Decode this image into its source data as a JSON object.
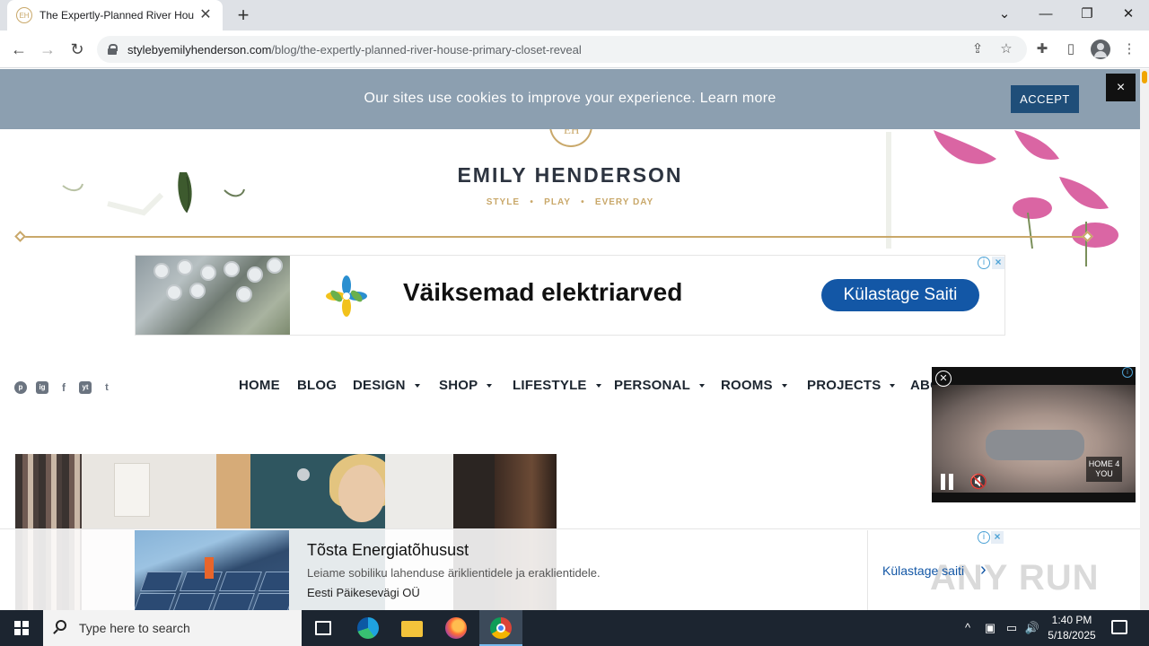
{
  "browser": {
    "tab_title": "The Expertly-Planned River House",
    "tab_favicon": "EH",
    "url_host": "stylebyemilyhenderson.com",
    "url_path": "/blog/the-expertly-planned-river-house-primary-closet-reveal",
    "new_tab": "+",
    "close_glyph": "✕"
  },
  "cookie": {
    "text": "Our sites use cookies to improve your experience. Learn more",
    "accept": "ACCEPT",
    "close": "×"
  },
  "header": {
    "emblem": "EH",
    "brand": "EMILY HENDERSON",
    "tagline": "STYLE   •   PLAY   •   EVERY DAY"
  },
  "ad_top": {
    "headline": "Väiksemad elektriarved",
    "cta": "Külastage Saiti"
  },
  "social": [
    "p",
    "ig",
    "f",
    "yt",
    "t"
  ],
  "nav": {
    "items": [
      "HOME",
      "BLOG",
      "DESIGN",
      "SHOP",
      "LIFESTYLE",
      "PERSONAL",
      "ROOMS",
      "PROJECTS",
      "ABOUT"
    ]
  },
  "video": {
    "close": "✕",
    "brand": "HOME 4 YOU",
    "mute": "🔇"
  },
  "ad_bottom": {
    "headline": "Tõsta Energiatõhusust",
    "description": "Leiame sobiliku lahenduse äriklientidele ja eraklientidele.",
    "advertiser": "Eesti Päikesevägi OÜ",
    "cta": "Külastage saiti",
    "chevron": "›",
    "watermark": "ANY RUN"
  },
  "taskbar": {
    "search_placeholder": "Type here to search",
    "time": "1:40 PM",
    "date": "5/18/2025"
  },
  "colors": {
    "gold": "#c9a86a",
    "navy": "#2d3440",
    "cookie_bar": "#8c9fb0",
    "accept_button": "#1f4e79",
    "ad_cta": "#1357a6"
  }
}
